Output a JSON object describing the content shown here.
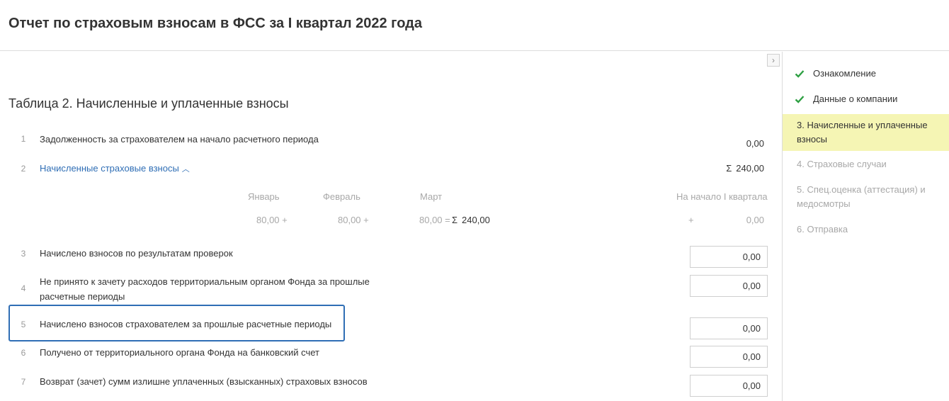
{
  "page": {
    "title": "Отчет по страховым взносам в ФСС за I квартал 2022 года"
  },
  "main": {
    "collapse_icon": "›",
    "section_title": "Таблица 2. Начисленные и уплаченные взносы",
    "rows": [
      {
        "num": "1",
        "label": "Задолженность за страхователем на начало расчетного периода",
        "value": "0,00"
      },
      {
        "num": "2",
        "label": "Начисленные страховые взносы",
        "value": "240,00",
        "sigma": "Σ"
      },
      {
        "num": "3",
        "label": "Начислено взносов по результатам проверок",
        "value": "0,00"
      },
      {
        "num": "4",
        "label": "Не принято к зачету расходов территориальным органом Фонда за прошлые расчетные периоды",
        "value": "0,00"
      },
      {
        "num": "5",
        "label": "Начислено взносов страхователем за прошлые расчетные периоды",
        "value": "0,00"
      },
      {
        "num": "6",
        "label": "Получено от территориального органа Фонда на банковский счет",
        "value": "0,00"
      },
      {
        "num": "7",
        "label": "Возврат (зачет) сумм излишне уплаченных (взысканных) страховых взносов",
        "value": "0,00"
      }
    ],
    "breakdown": {
      "headers": {
        "jan": "Январь",
        "feb": "Февраль",
        "mar": "Март",
        "start": "На начало I квартала"
      },
      "values": {
        "jan": "80,00 +",
        "feb": "80,00 +",
        "mar": "80,00 =",
        "sigma": "Σ",
        "sum": "240,00",
        "plus": "+",
        "start": "0,00"
      }
    }
  },
  "sidebar": {
    "steps": [
      {
        "label": "Ознакомление",
        "state": "done"
      },
      {
        "label": "Данные о компании",
        "state": "done"
      },
      {
        "label": "3.  Начисленные и уплаченные взносы",
        "state": "active"
      },
      {
        "label": "4.  Страховые случаи",
        "state": "pending"
      },
      {
        "label": "5.  Спец.оценка (аттестация) и медосмотры",
        "state": "pending"
      },
      {
        "label": "6.  Отправка",
        "state": "pending"
      }
    ]
  },
  "colors": {
    "link": "#2f6eb5",
    "active_step_bg": "#f5f5b4",
    "check": "#2ea043",
    "highlight_border": "#2f6eb5"
  }
}
